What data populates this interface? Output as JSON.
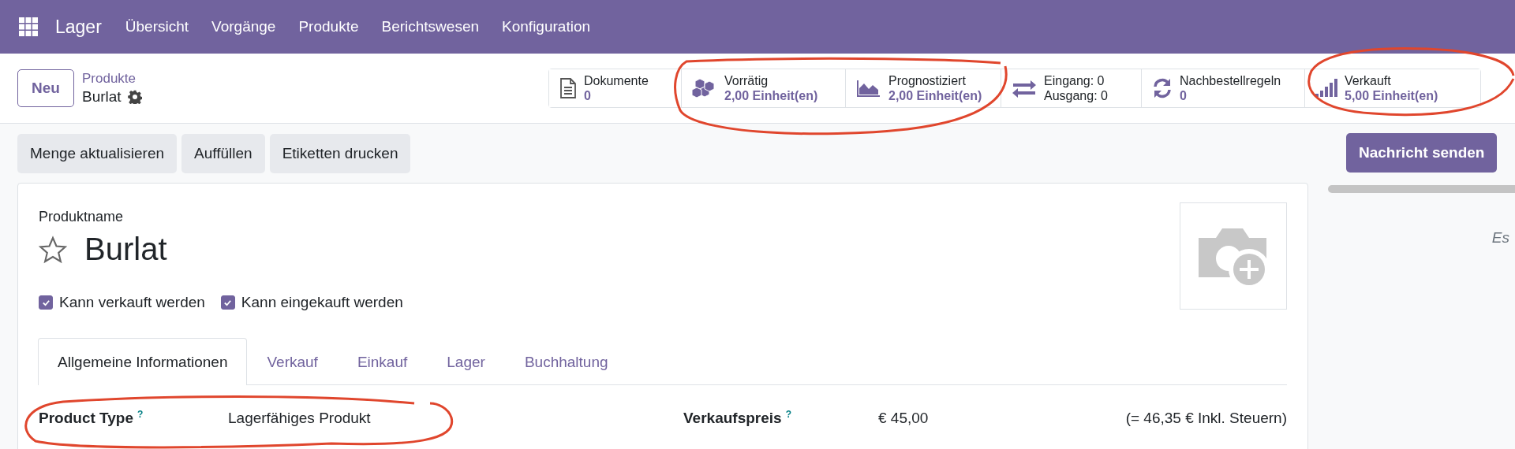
{
  "navbar": {
    "app": "Lager",
    "menu": [
      "Übersicht",
      "Vorgänge",
      "Produkte",
      "Berichtswesen",
      "Konfiguration"
    ]
  },
  "control_panel": {
    "new_button": "Neu",
    "breadcrumb": "Produkte",
    "record": "Burlat"
  },
  "stat_buttons": [
    {
      "kind": "document",
      "label": "Dokumente",
      "value": "0"
    },
    {
      "kind": "cubes",
      "label": "Vorrätig",
      "value": "2,00 Einheit(en)"
    },
    {
      "kind": "area",
      "label": "Prognostiziert",
      "value": "2,00 Einheit(en)"
    },
    {
      "kind": "transfer",
      "label": "Eingang: 0",
      "value": "Ausgang: 0"
    },
    {
      "kind": "refresh",
      "label": "Nachbestellregeln",
      "value": "0"
    },
    {
      "kind": "signal",
      "label": "Verkauft",
      "value": "5,00 Einheit(en)"
    }
  ],
  "actions": [
    "Menge aktualisieren",
    "Auffüllen",
    "Etiketten drucken"
  ],
  "chatter": {
    "send_button": "Nachricht senden",
    "note": "Es"
  },
  "form": {
    "name_label": "Produktname",
    "name": "Burlat",
    "favorite": false,
    "options": [
      {
        "label": "Kann verkauft werden",
        "checked": true
      },
      {
        "label": "Kann eingekauft werden",
        "checked": true
      }
    ],
    "tabs": [
      {
        "label": "Allgemeine Informationen",
        "selected": true
      },
      {
        "label": "Verkauf",
        "selected": false
      },
      {
        "label": "Einkauf",
        "selected": false
      },
      {
        "label": "Lager",
        "selected": false
      },
      {
        "label": "Buchhaltung",
        "selected": false
      }
    ],
    "fields": [
      {
        "label": "Product Type",
        "help": "?",
        "value": "Lagerfähiges Produkt"
      },
      {
        "label": "Verkaufspreis",
        "help": "?",
        "value": "€ 45,00",
        "note": "(= 46,35 € Inkl. Steuern)"
      }
    ]
  }
}
